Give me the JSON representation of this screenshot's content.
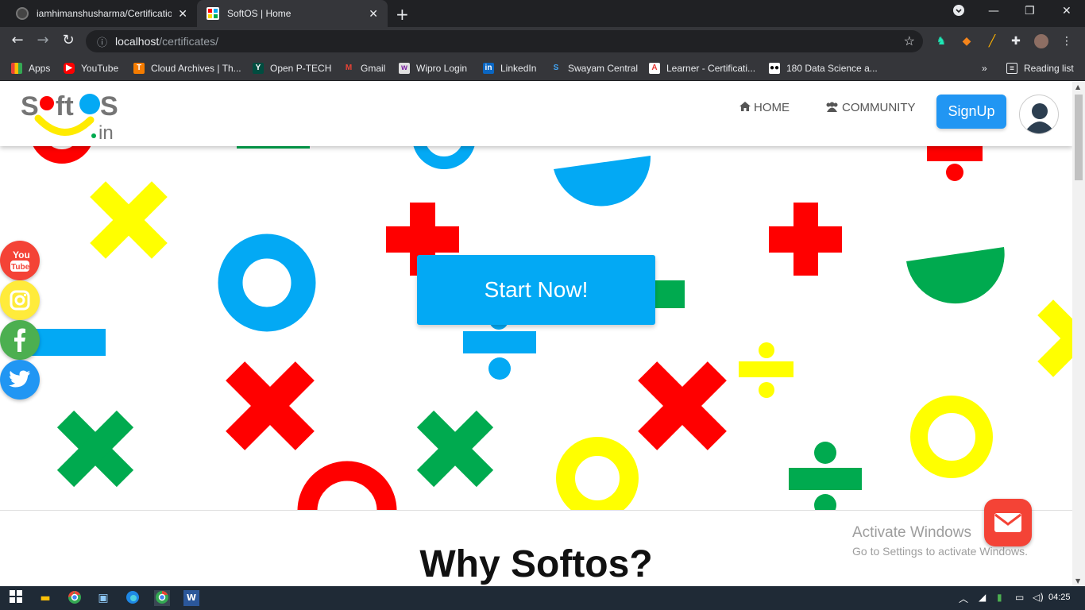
{
  "browser": {
    "tabs": [
      {
        "title": "iamhimanshusharma/Certification"
      },
      {
        "title": "SoftOS | Home"
      }
    ],
    "url_host": "localhost",
    "url_path": "/certificates/",
    "bookmarks": [
      {
        "label": "Apps",
        "icon": "apps-icon",
        "color": "#ea4335"
      },
      {
        "label": "YouTube",
        "icon": "youtube-icon",
        "color": "#ff0000"
      },
      {
        "label": "Cloud Archives | Th...",
        "icon": "cloud-archives-icon",
        "color": "#f57c00"
      },
      {
        "label": "Open P-TECH",
        "icon": "ptech-icon",
        "color": "#00897b"
      },
      {
        "label": "Gmail",
        "icon": "gmail-icon",
        "color": "#ea4335"
      },
      {
        "label": "Wipro Login",
        "icon": "wipro-icon",
        "color": "#e0e0e0"
      },
      {
        "label": "LinkedIn",
        "icon": "linkedin-icon",
        "color": "#0a66c2"
      },
      {
        "label": "Swayam Central",
        "icon": "swayam-icon",
        "color": "#1565c0"
      },
      {
        "label": "Learner - Certificati...",
        "icon": "adobe-icon",
        "color": "#e53935"
      },
      {
        "label": "180 Data Science a...",
        "icon": "medium-icon",
        "color": "#000000"
      }
    ],
    "reading_list": "Reading list"
  },
  "navbar": {
    "logo_alt": "Softos.in",
    "home": "HOME",
    "community": "COMMUNITY",
    "signup": "SignUp"
  },
  "hero": {
    "cta": "Start Now!"
  },
  "section": {
    "heading": "Why Softos?"
  },
  "watermark": {
    "line1": "Activate Windows",
    "line2": "Go to Settings to activate Windows."
  },
  "taskbar": {
    "time": "04:25"
  },
  "colors": {
    "red": "#ff0000",
    "yellow": "#ffff00",
    "blue": "#03a9f4",
    "green": "#00aa4f",
    "signup": "#2196f3"
  }
}
